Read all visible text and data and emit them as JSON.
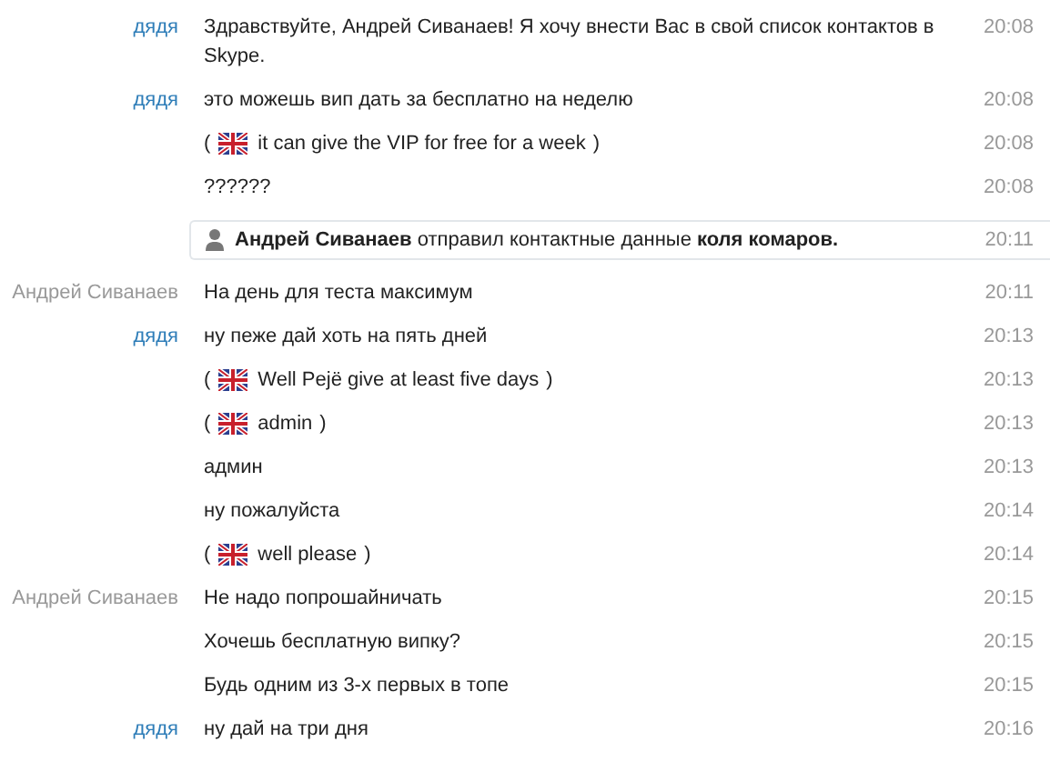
{
  "messages": [
    {
      "kind": "message",
      "sender": "дядя",
      "color": "#2e7db8",
      "text": "Здравствуйте, Андрей Сиванаев! Я хочу внести Вас в свой список контактов в Skype.",
      "time": "20:08"
    },
    {
      "kind": "message",
      "sender": "дядя",
      "color": "#2e7db8",
      "text": "это можешь вип дать за бесплатно на неделю",
      "time": "20:08"
    },
    {
      "kind": "translation",
      "prefix": "(",
      "text": "it can give the VIP for free for a week",
      "suffix": ")",
      "time": "20:08"
    },
    {
      "kind": "message",
      "text": "??????",
      "time": "20:08"
    },
    {
      "kind": "system",
      "text": "**Андрей Сиванаев** отправил контактные данные **коля комаров.**",
      "time": "20:11"
    },
    {
      "kind": "message",
      "sender": "Андрей Сиванаев",
      "color": "#999999",
      "text": "На день для теста максимум",
      "time": "20:11"
    },
    {
      "kind": "message",
      "sender": "дядя",
      "color": "#2e7db8",
      "text": "ну пеже дай хоть на пять дней",
      "time": "20:13"
    },
    {
      "kind": "translation",
      "prefix": "(",
      "text": "Well Pejë give at least five days",
      "suffix": ")",
      "time": "20:13"
    },
    {
      "kind": "translation",
      "prefix": "(",
      "text": "admin",
      "suffix": ")",
      "time": "20:13"
    },
    {
      "kind": "message",
      "text": "админ",
      "time": "20:13"
    },
    {
      "kind": "message",
      "text": "ну пожалуйста",
      "time": "20:14"
    },
    {
      "kind": "translation",
      "prefix": "(",
      "text": "well please",
      "suffix": ")",
      "time": "20:14"
    },
    {
      "kind": "message",
      "sender": "Андрей Сиванаев",
      "color": "#999999",
      "text": "Не надо попрошайничать",
      "time": "20:15"
    },
    {
      "kind": "message",
      "text": "Хочешь бесплатную випку?",
      "time": "20:15"
    },
    {
      "kind": "message",
      "text": "Будь одним из 3-х первых в топе",
      "time": "20:15"
    },
    {
      "kind": "message",
      "sender": "дядя",
      "color": "#2e7db8",
      "text": "ну дай на три дня",
      "time": "20:16"
    }
  ]
}
